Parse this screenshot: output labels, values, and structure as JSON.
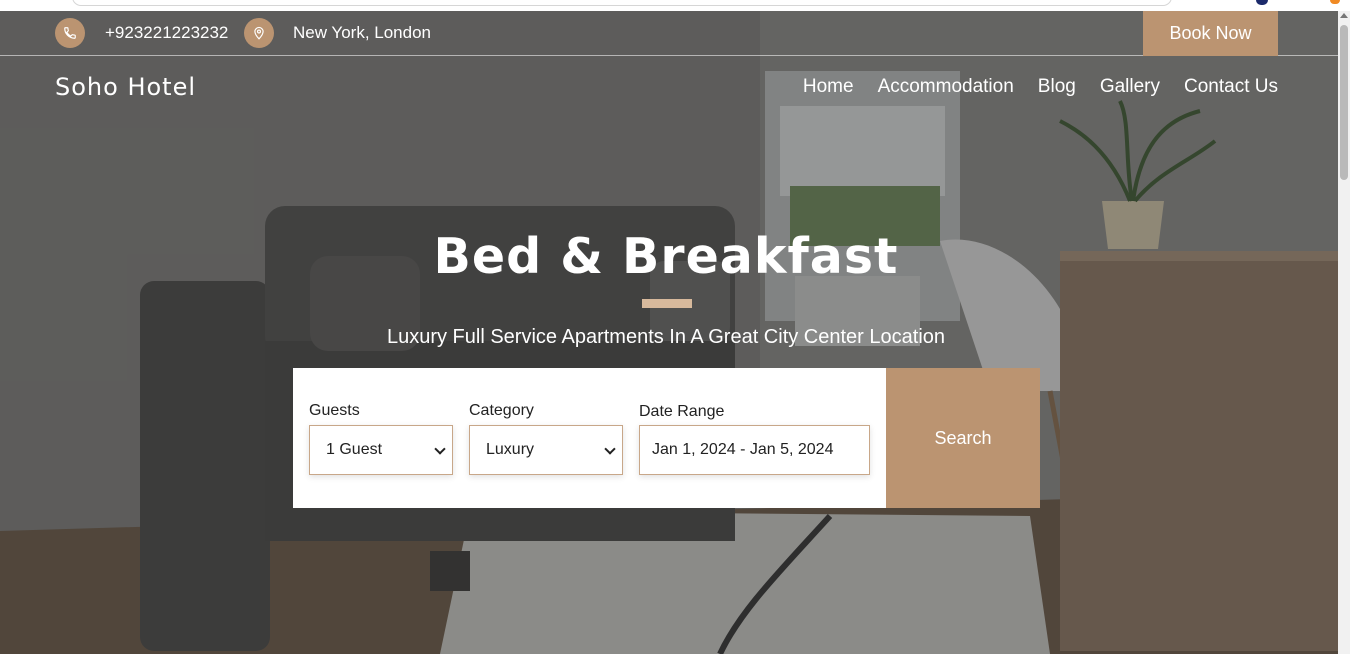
{
  "topbar": {
    "phone": "+923221223232",
    "location": "New York, London",
    "book_label": "Book Now"
  },
  "brand": "Soho Hotel",
  "nav": {
    "items": [
      {
        "label": "Home"
      },
      {
        "label": "Accommodation"
      },
      {
        "label": "Blog"
      },
      {
        "label": "Gallery"
      },
      {
        "label": "Contact Us"
      }
    ]
  },
  "hero": {
    "title": "Bed & Breakfast",
    "subtitle": "Luxury Full Service Apartments In A Great City Center Location"
  },
  "booking": {
    "guests_label": "Guests",
    "guests_value": "1 Guest",
    "category_label": "Category",
    "category_value": "Luxury",
    "date_label": "Date Range",
    "date_value": "Jan 1, 2024 - Jan 5, 2024",
    "search_label": "Search"
  },
  "colors": {
    "accent": "#bb9471",
    "divider": "#d7b99c"
  },
  "icons": {
    "phone": "phone-icon",
    "location": "map-pin-icon"
  }
}
